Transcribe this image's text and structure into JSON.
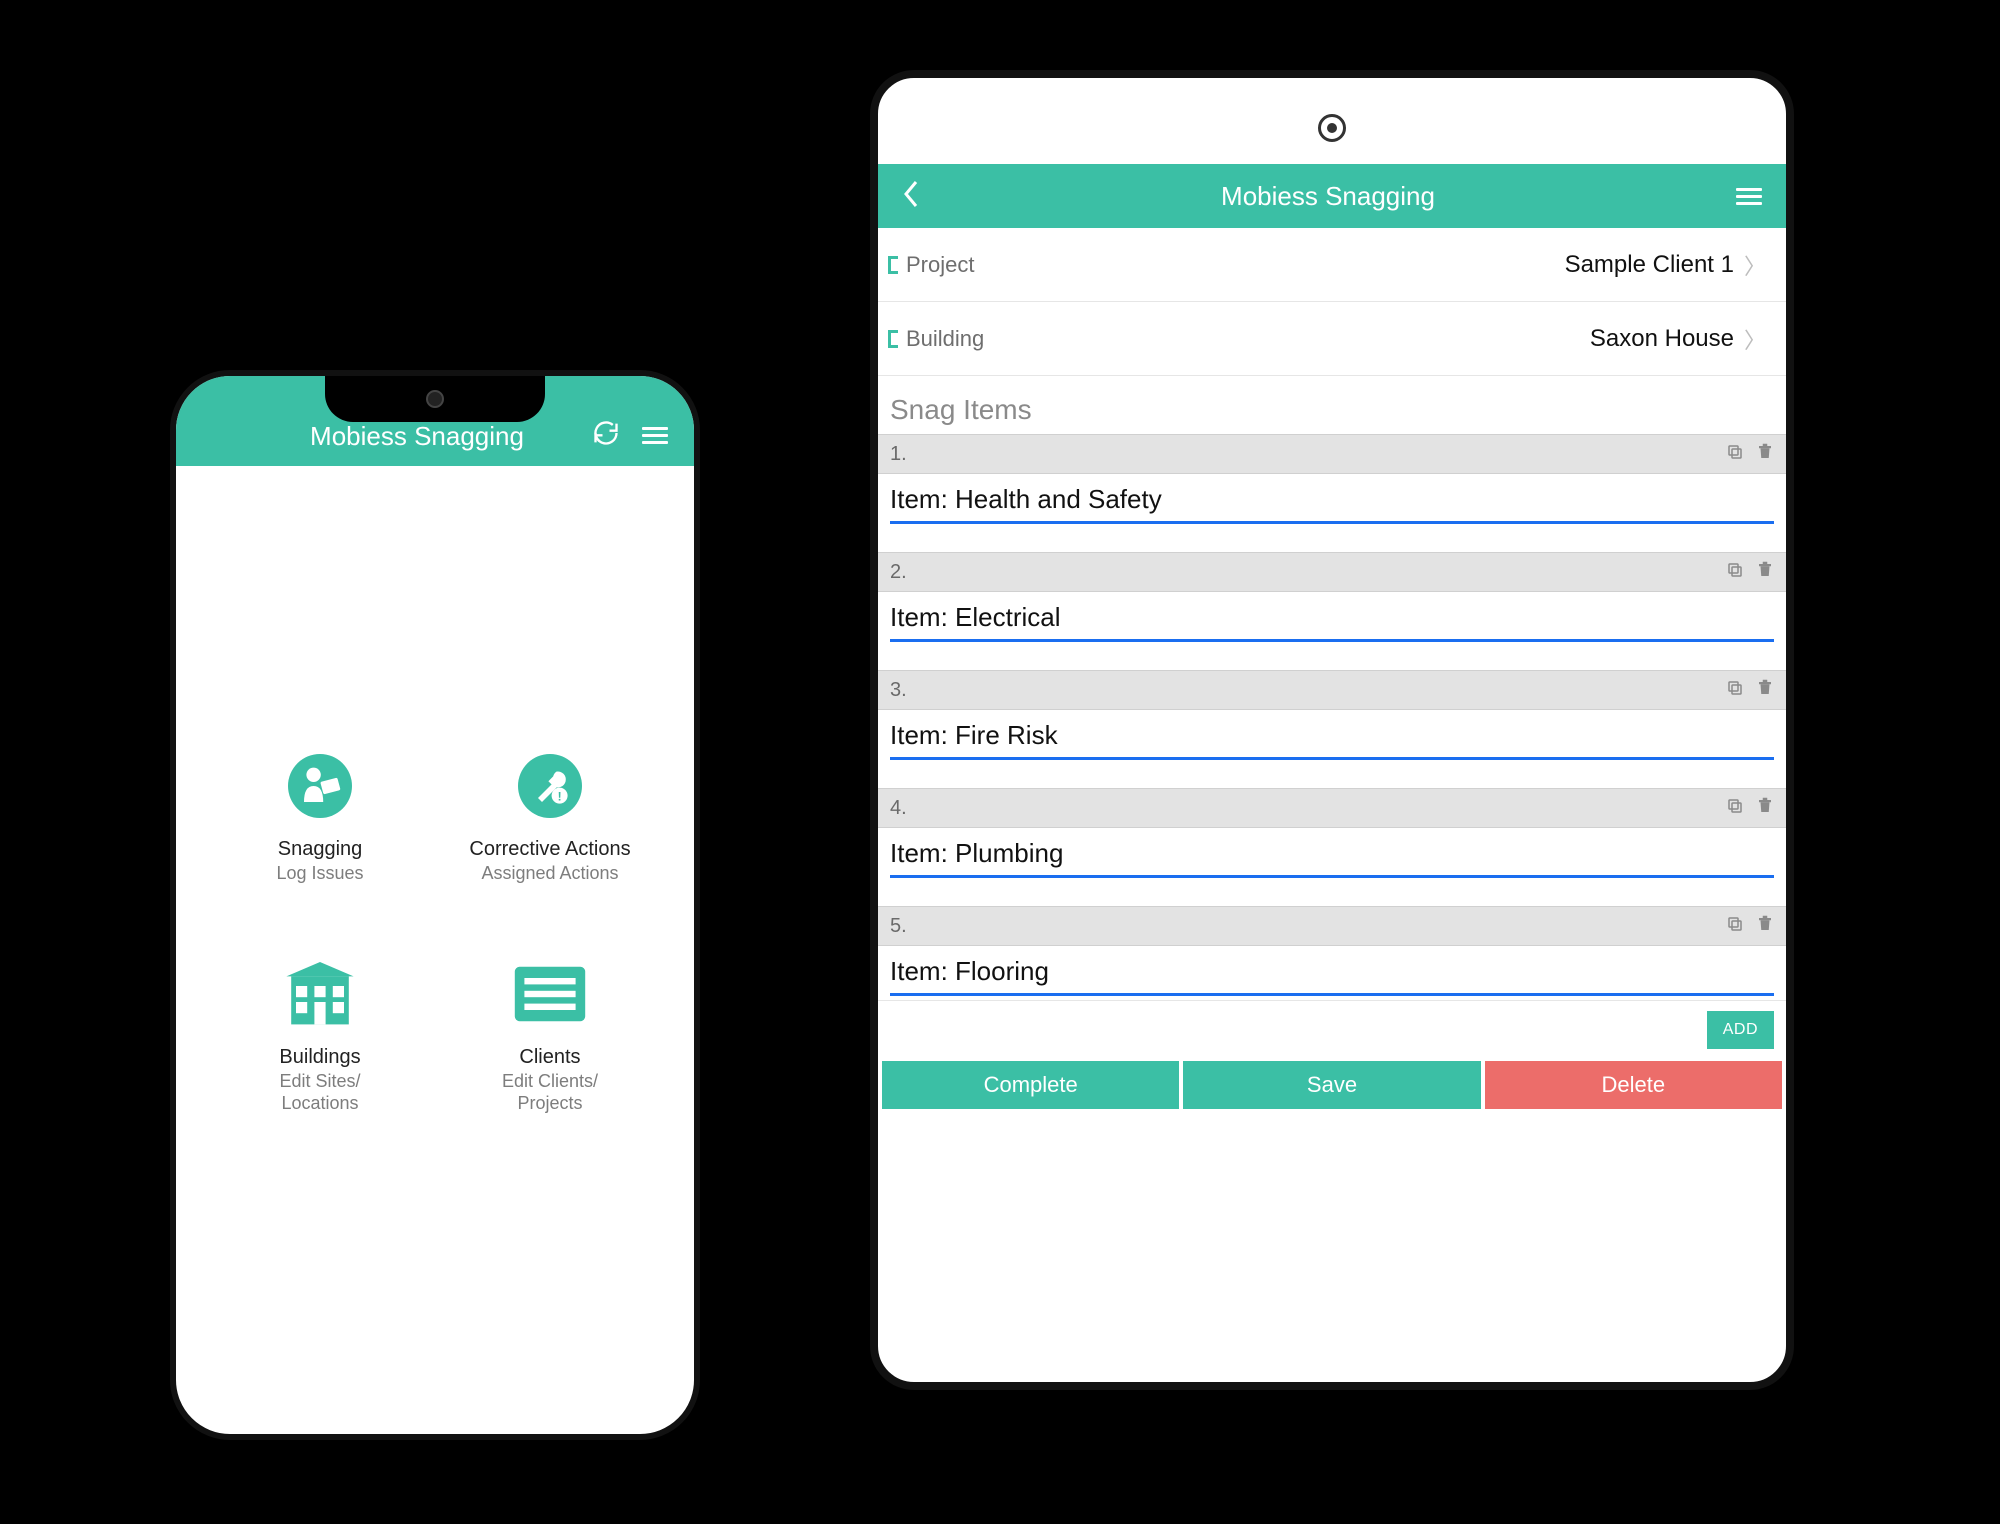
{
  "colors": {
    "teal": "#3bbfa5",
    "red": "#ec6d6a",
    "blue_underline": "#1a6ef0"
  },
  "phone": {
    "header": {
      "title": "Mobiess Snagging"
    },
    "tiles": [
      {
        "title": "Snagging",
        "subtitle": "Log Issues",
        "icon": "worker-clipboard-icon"
      },
      {
        "title": "Corrective Actions",
        "subtitle": "Assigned Actions",
        "icon": "tools-alert-icon"
      },
      {
        "title": "Buildings",
        "subtitle": "Edit Sites/\nLocations",
        "icon": "building-icon"
      },
      {
        "title": "Clients",
        "subtitle": "Edit Clients/\nProjects",
        "icon": "list-card-icon"
      }
    ]
  },
  "tablet": {
    "header": {
      "title": "Mobiess Snagging"
    },
    "info": {
      "project": {
        "label": "Project",
        "value": "Sample Client 1"
      },
      "building": {
        "label": "Building",
        "value": "Saxon House"
      }
    },
    "section_title": "Snag Items",
    "items": [
      {
        "num": "1.",
        "label": "Item: Health and Safety"
      },
      {
        "num": "2.",
        "label": "Item: Electrical"
      },
      {
        "num": "3.",
        "label": "Item: Fire Risk"
      },
      {
        "num": "4.",
        "label": "Item: Plumbing"
      },
      {
        "num": "5.",
        "label": "Item: Flooring"
      }
    ],
    "buttons": {
      "add": "ADD",
      "complete": "Complete",
      "save": "Save",
      "delete": "Delete"
    }
  }
}
